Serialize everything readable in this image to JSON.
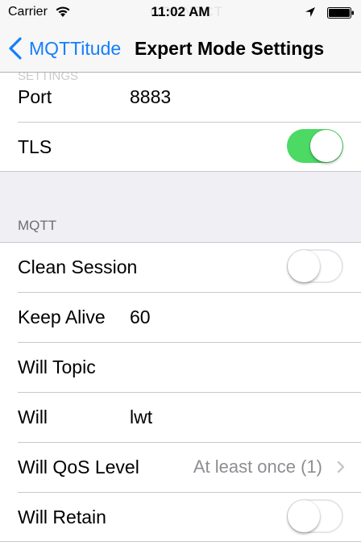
{
  "status_bar": {
    "carrier": "Carrier",
    "time": "11:02 AM",
    "ghost_text": "CONNECT",
    "icons": [
      "wifi-icon",
      "location-arrow-icon",
      "battery-icon"
    ]
  },
  "nav": {
    "back_label": "MQTTitude",
    "title": "Expert Mode Settings",
    "accent_color": "#157efb"
  },
  "obscured_header": "SETTINGS",
  "connection": {
    "port_label": "Port",
    "port_value": "8883",
    "tls_label": "TLS",
    "tls_on": true
  },
  "mqtt": {
    "header": "MQTT",
    "clean_session_label": "Clean Session",
    "clean_session_on": false,
    "keep_alive_label": "Keep Alive",
    "keep_alive_value": "60",
    "will_topic_label": "Will Topic",
    "will_topic_value": "",
    "will_label": "Will",
    "will_value": "lwt",
    "will_qos_label": "Will QoS Level",
    "will_qos_value": "At least once (1)",
    "will_retain_label": "Will Retain",
    "will_retain_on": false
  },
  "colors": {
    "switch_on": "#4cd964",
    "background": "#efeff4"
  }
}
